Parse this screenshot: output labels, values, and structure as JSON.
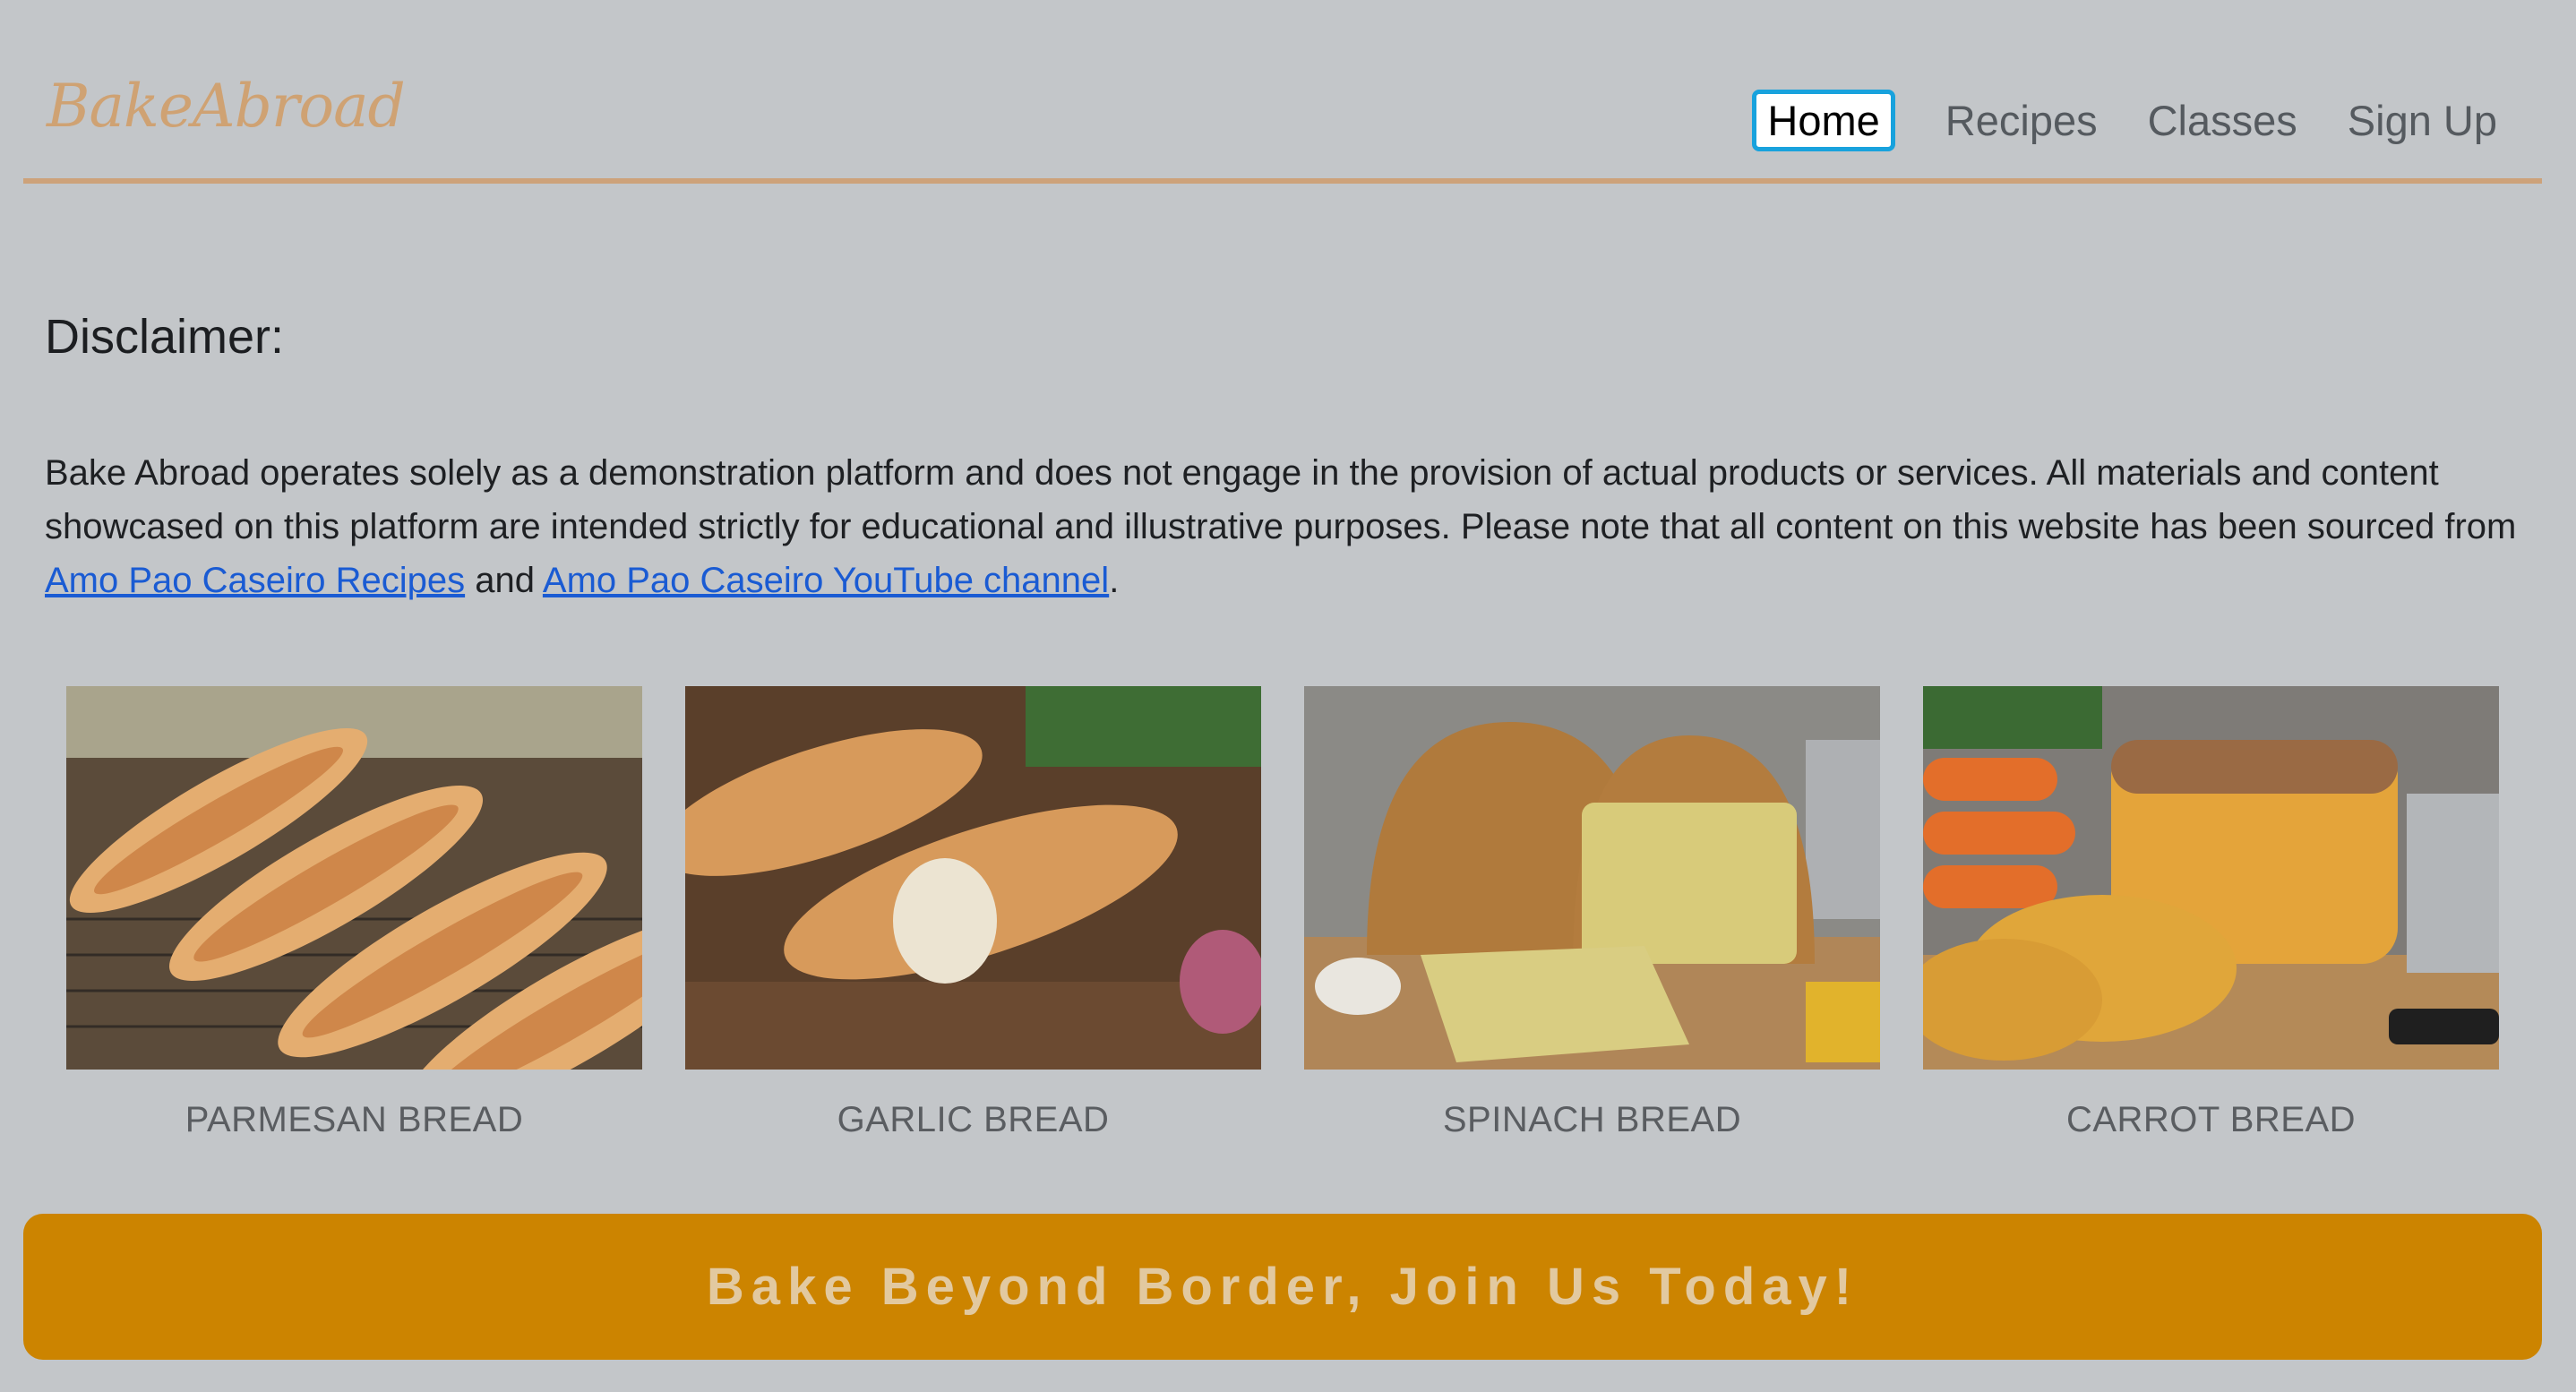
{
  "brand": {
    "logo_text": "BakeAbroad"
  },
  "nav": {
    "items": [
      {
        "label": "Home",
        "active": true
      },
      {
        "label": "Recipes",
        "active": false
      },
      {
        "label": "Classes",
        "active": false
      },
      {
        "label": "Sign Up",
        "active": false
      }
    ]
  },
  "disclaimer": {
    "title": "Disclaimer:",
    "body": "Bake Abroad operates solely as a demonstration platform and does not engage in the provision of actual products or services. All materials and content showcased on this platform are intended strictly for educational and illustrative purposes. Please note that all content on this website has been sourced from",
    "link1": "Amo Pao Caseiro Recipes",
    "connector": "and",
    "link2": "Amo Pao Caseiro YouTube channel",
    "end": "."
  },
  "gallery": {
    "items": [
      {
        "label": "PARMESAN BREAD",
        "icon": "parmesan-bread-image"
      },
      {
        "label": "GARLIC BREAD",
        "icon": "garlic-bread-image"
      },
      {
        "label": "SPINACH BREAD",
        "icon": "spinach-bread-image"
      },
      {
        "label": "CARROT BREAD",
        "icon": "carrot-bread-image"
      }
    ]
  },
  "cta": {
    "label": "Bake Beyond Border, Join Us Today!"
  },
  "colors": {
    "background": "#c3c6c9",
    "brand": "#cfa273",
    "accent_line": "#cda27a",
    "cta": "#cc8400",
    "cta_text": "#e2c9a0",
    "link": "#1a5bd3",
    "focus_ring": "#18a2dd"
  }
}
